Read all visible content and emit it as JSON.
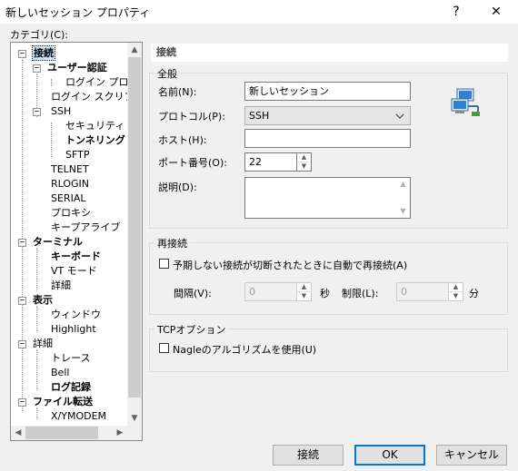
{
  "window": {
    "title": "新しいセッション プロパティ",
    "help_glyph": "?",
    "close_glyph": "✕"
  },
  "category": {
    "label": "カテゴリ(C):",
    "items": [
      {
        "label": "接続",
        "bold": true,
        "selected": true
      },
      {
        "label": "ユーザー認証",
        "bold": true
      },
      {
        "label": "ログイン プロン",
        "bold": false
      },
      {
        "label": "ログイン スクリプト",
        "bold": false
      },
      {
        "label": "SSH",
        "bold": false
      },
      {
        "label": "セキュリティ",
        "bold": false
      },
      {
        "label": "トンネリング",
        "bold": true
      },
      {
        "label": "SFTP",
        "bold": false
      },
      {
        "label": "TELNET",
        "bold": false
      },
      {
        "label": "RLOGIN",
        "bold": false
      },
      {
        "label": "SERIAL",
        "bold": false
      },
      {
        "label": "プロキシ",
        "bold": false
      },
      {
        "label": "キープアライブ",
        "bold": false
      },
      {
        "label": "ターミナル",
        "bold": true
      },
      {
        "label": "キーボード",
        "bold": true
      },
      {
        "label": "VT モード",
        "bold": false
      },
      {
        "label": "詳細",
        "bold": false
      },
      {
        "label": "表示",
        "bold": true
      },
      {
        "label": "ウィンドウ",
        "bold": false
      },
      {
        "label": "Highlight",
        "bold": false
      },
      {
        "label": "詳細",
        "bold": false
      },
      {
        "label": "トレース",
        "bold": false
      },
      {
        "label": "Bell",
        "bold": false
      },
      {
        "label": "ログ記録",
        "bold": true
      },
      {
        "label": "ファイル転送",
        "bold": true
      },
      {
        "label": "X/YMODEM",
        "bold": false
      }
    ]
  },
  "page": {
    "header": "接続",
    "general": {
      "title": "全般",
      "name_label": "名前(N):",
      "name_value": "新しいセッション",
      "protocol_label": "プロトコル(P):",
      "protocol_value": "SSH",
      "host_label": "ホスト(H):",
      "host_value": "",
      "port_label": "ポート番号(O):",
      "port_value": "22",
      "desc_label": "説明(D):",
      "desc_value": ""
    },
    "reconnect": {
      "title": "再接続",
      "auto_label": "予期しない接続が切断されたときに自動で再接続(A)",
      "auto_checked": false,
      "interval_label": "間隔(V):",
      "interval_value": "0",
      "interval_unit": "秒",
      "limit_label": "制限(L):",
      "limit_value": "0",
      "limit_unit": "分"
    },
    "tcp": {
      "title": "TCPオプション",
      "nagle_label": "Nagleのアルゴリズムを使用(U)",
      "nagle_checked": false
    }
  },
  "buttons": {
    "connect": "接続",
    "ok": "OK",
    "cancel": "キャンセル"
  },
  "icons": {
    "network": "network-computers-icon",
    "accent": "#0078d7"
  }
}
